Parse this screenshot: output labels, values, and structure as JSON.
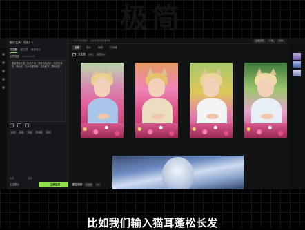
{
  "background_text": "极简",
  "app": {
    "left_panel": {
      "title": "图片工具 · 可灵2.1",
      "tabs": [
        "文生图",
        "图生图",
        "局部重绘"
      ],
      "section_label": "创意描述",
      "section_hint": "DeepSeek",
      "prompt_text": "猫耳蓬松长发，阳光少年，穿着白色衬衫，站在花海中，伸出手，日系动漫风格，高清细节，柔和光影",
      "options": [
        "比例",
        "数量",
        "风格",
        "参考图",
        "高清"
      ],
      "footer_left": "比例",
      "footer_right": "数量",
      "footer_label": "生成图片",
      "generate_button": "立即生成"
    },
    "main": {
      "breadcrumb": "< 今日已生成图片 · 点击生成内容查看详情",
      "topbar_buttons": [
        "生成记录",
        "下载",
        "分享"
      ],
      "tabs": [
        "全部",
        "图片",
        "视频",
        "已收藏"
      ],
      "active_tab": "全部",
      "record1": {
        "title": "文生图",
        "tags": [
          "1:1",
          "可灵2.1"
        ]
      },
      "record2": {
        "title": "图生视频",
        "tags": [
          "高品质",
          "5s"
        ]
      }
    }
  },
  "subtitle": "比如我们输入猫耳蓬松长发",
  "colors": {
    "accent": "#8fe04a",
    "panel": "#16171a"
  }
}
